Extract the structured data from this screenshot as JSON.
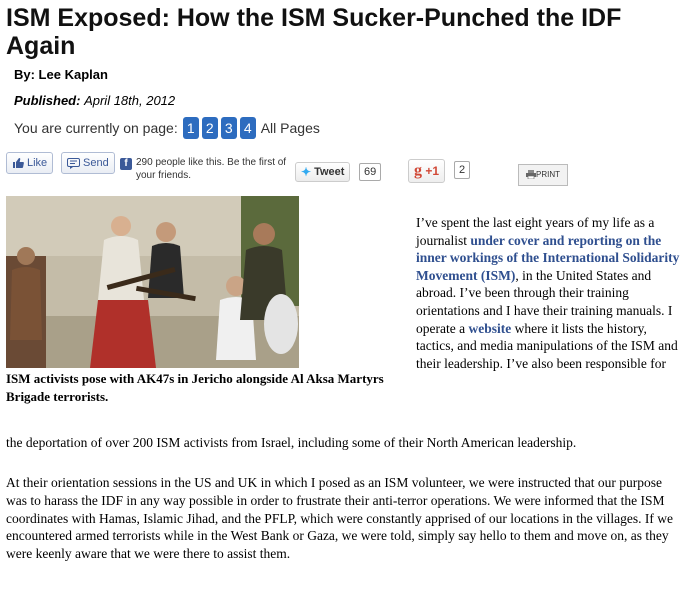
{
  "article": {
    "title": "ISM Exposed: How the ISM Sucker-Punched the IDF Again",
    "byline": "By: Lee Kaplan",
    "published_label": "Published:",
    "published_date": "April 18th, 2012"
  },
  "pager": {
    "label": "You are currently on page:",
    "pages": [
      "1",
      "2",
      "3",
      "4"
    ],
    "all_pages": "All Pages"
  },
  "share": {
    "like_label": "Like",
    "send_label": "Send",
    "fb_text": "290 people like this. Be the first of your friends.",
    "tweet_label": "Tweet",
    "tweet_count": "69",
    "gplus_label": "+1",
    "gplus_count": "2",
    "print_label": "PRINT"
  },
  "photo": {
    "caption": "ISM activists pose with AK47s in Jericho alongside Al Aksa Martyrs Brigade terrorists."
  },
  "body": {
    "p1_a": "I’ve spent the last eight years of my life as a journalist ",
    "p1_link1": "under cover and reporting on the inner workings of the International Solidarity Movement (ISM)",
    "p1_b": ", in the United States and abroad. I’ve been through their training orientations and I have their training manuals.  I operate a ",
    "p1_link2": "website",
    "p1_c": " where it lists the history, tactics, and media manipulations of the ISM and their leadership. I’ve also been responsible for",
    "p1_end": "the deportation of over 200 ISM activists from Israel, including some of their North American leadership.",
    "p2": "At their orientation sessions in the US and UK in which I posed as an ISM volunteer, we were  instructed that our purpose was to harass the IDF in any way possible in order to frustrate their anti-terror operations. We were informed that the ISM coordinates with Hamas, Islamic Jihad, and the PFLP, which were constantly apprised of our locations in the villages. If we encountered armed terrorists while in the West Bank or Gaza, we were told, simply say hello to them and move on, as they were keenly aware that we were there to assist them."
  }
}
